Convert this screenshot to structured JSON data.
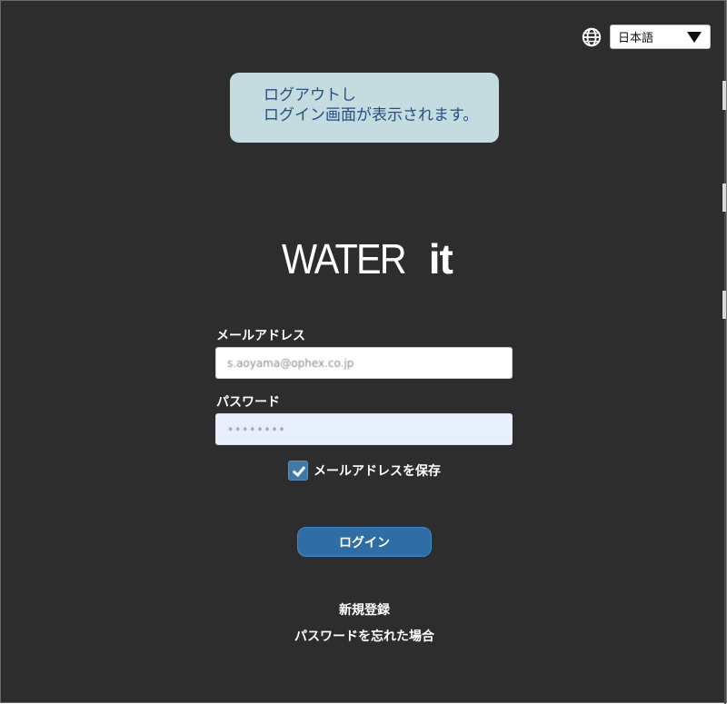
{
  "language": {
    "icon": "globe-icon",
    "selected": "日本語"
  },
  "tooltip": {
    "line1": "ログアウトし",
    "line2": "ログイン画面が表示されます。"
  },
  "logo": {
    "light": "WATER",
    "bold": "it"
  },
  "form": {
    "email_label": "メールアドレス",
    "email_value": "s.aoyama@ophex.co.jp",
    "password_label": "パスワード",
    "password_value": "••••••••",
    "remember_label": "メールアドレスを保存",
    "remember_checked": true,
    "login_button": "ログイン"
  },
  "links": {
    "register": "新規登録",
    "forgot_password": "パスワードを忘れた場合"
  },
  "colors": {
    "background": "#2d2d2d",
    "tooltip_background": "#c4dbe0",
    "tooltip_text": "#284f81",
    "button_background": "#2f6da5",
    "checkbox": "#3f79a7",
    "password_field": "#e8f0fe"
  }
}
